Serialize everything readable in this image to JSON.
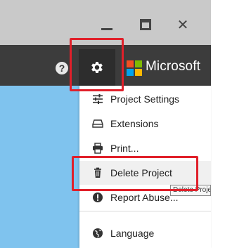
{
  "window_controls": {
    "minimize_icon": "minimize-icon",
    "maximize_icon": "maximize-icon",
    "close_icon": "close-icon",
    "close_glyph": "✕"
  },
  "appbar": {
    "help_glyph": "?",
    "brand_text": "Microsoft",
    "brand_colors": [
      "#f25022",
      "#7fba00",
      "#00a4ef",
      "#ffb900"
    ]
  },
  "menu": {
    "items": [
      {
        "label": "Project Settings",
        "icon": "sliders-icon"
      },
      {
        "label": "Extensions",
        "icon": "tray-icon"
      },
      {
        "label": "Print...",
        "icon": "printer-icon"
      },
      {
        "label": "Delete Project",
        "icon": "trash-icon"
      },
      {
        "label": "Report Abuse...",
        "icon": "exclamation-circle-icon"
      },
      {
        "label": "Language",
        "icon": "globe-icon"
      }
    ]
  },
  "tooltip": {
    "text": "Delete Project"
  },
  "colors": {
    "highlight": "#e0202a",
    "appbar": "#3c3c3c",
    "content": "#7fc3ee"
  }
}
